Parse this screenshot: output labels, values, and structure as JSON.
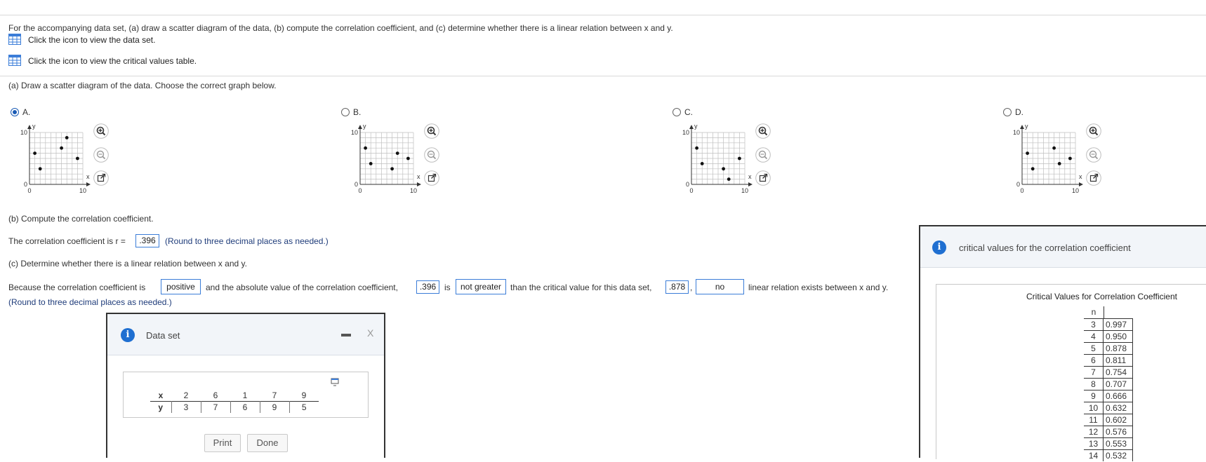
{
  "question": {
    "intro": "For the accompanying data set, (a) draw a scatter diagram of the data, (b) compute the correlation coefficient, and (c) determine whether there is a linear relation between x and y.",
    "data_link": "Click the icon to view the data set.",
    "critical_link": "Click the icon to view the critical values table."
  },
  "part_a": {
    "prompt": "(a) Draw a scatter diagram of the data. Choose the correct graph below.",
    "selected": "A",
    "options": [
      {
        "label": "A.",
        "points": [
          [
            1,
            6
          ],
          [
            2,
            3
          ],
          [
            6,
            7
          ],
          [
            7,
            9
          ],
          [
            9,
            5
          ]
        ]
      },
      {
        "label": "B.",
        "points": [
          [
            1,
            7
          ],
          [
            2,
            4
          ],
          [
            6,
            3
          ],
          [
            7,
            6
          ],
          [
            9,
            5
          ]
        ]
      },
      {
        "label": "C.",
        "points": [
          [
            1,
            7
          ],
          [
            2,
            4
          ],
          [
            6,
            3
          ],
          [
            7,
            1
          ],
          [
            9,
            5
          ]
        ]
      },
      {
        "label": "D.",
        "points": [
          [
            1,
            6
          ],
          [
            2,
            3
          ],
          [
            6,
            7
          ],
          [
            7,
            4
          ],
          [
            9,
            5
          ]
        ]
      }
    ],
    "axis": {
      "y_label": "y",
      "x_label": "x",
      "y_max_tick": "10",
      "y_min_tick": "0",
      "x_min_tick": "0",
      "x_max_tick": "10"
    }
  },
  "part_b": {
    "prompt": "(b) Compute the correlation coefficient.",
    "sentence_start": "The correlation coefficient is r =",
    "r_value": ".396",
    "round_note": "(Round to three decimal places as needed.)"
  },
  "part_c": {
    "prompt": "(c) Determine whether there is a linear relation between x and y.",
    "s1": "Because the correlation coefficient is",
    "sign": "positive",
    "s2": "and the absolute value of the correlation coefficient,",
    "abs_r": ".396",
    "s3": "is",
    "comparison": "not greater",
    "s4": "than the critical value for this data set,",
    "critical": ".878",
    "s5": ",",
    "exists": "no",
    "s6": "linear relation exists between x and y.",
    "round_note": "(Round to three decimal places as needed.)"
  },
  "data_panel": {
    "title": "Data set",
    "minimize": "—",
    "close": "X",
    "x_label": "x",
    "y_label": "y",
    "x_values": [
      "2",
      "6",
      "1",
      "7",
      "9"
    ],
    "y_values": [
      "3",
      "7",
      "6",
      "9",
      "5"
    ],
    "print": "Print",
    "done": "Done"
  },
  "critical_panel": {
    "header": "critical values for the correlation coefficient",
    "table_title": "Critical Values for Correlation Coefficient",
    "n_label": "n",
    "rows": [
      [
        "3",
        "0.997"
      ],
      [
        "4",
        "0.950"
      ],
      [
        "5",
        "0.878"
      ],
      [
        "6",
        "0.811"
      ],
      [
        "7",
        "0.754"
      ],
      [
        "8",
        "0.707"
      ],
      [
        "9",
        "0.666"
      ],
      [
        "10",
        "0.632"
      ],
      [
        "11",
        "0.602"
      ],
      [
        "12",
        "0.576"
      ],
      [
        "13",
        "0.553"
      ],
      [
        "14",
        "0.532"
      ]
    ]
  },
  "colors": {
    "accent": "#1f6fd1",
    "answer_border": "#3b7dd8"
  }
}
